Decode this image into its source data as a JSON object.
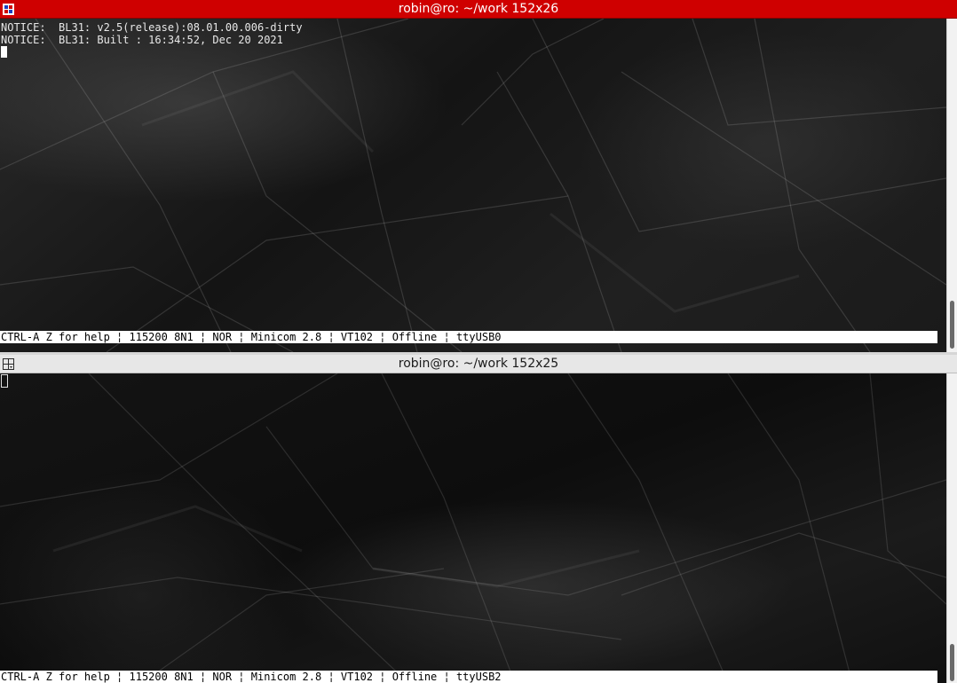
{
  "panes": [
    {
      "title": "robin@ro: ~/work 152x26",
      "lines": [
        "NOTICE:  BL31: v2.5(release):08.01.00.006-dirty",
        "NOTICE:  BL31: Built : 16:34:52, Dec 20 2021"
      ],
      "status": "CTRL-A Z for help ¦ 115200 8N1 ¦ NOR ¦ Minicom 2.8 ¦ VT102 ¦ Offline ¦ ttyUSB0",
      "active": true
    },
    {
      "title": "robin@ro: ~/work 152x25",
      "lines": [],
      "status": "CTRL-A Z for help ¦ 115200 8N1 ¦ NOR ¦ Minicom 2.8 ¦ VT102 ¦ Offline ¦ ttyUSB2",
      "active": false
    }
  ],
  "colors": {
    "active_titlebar": "#cf0000",
    "inactive_titlebar": "#e7e7e7",
    "terminal_text": "#e8e8e8",
    "statusbar_bg": "#ffffff"
  },
  "icons": {
    "pane_icon": "terminal-split-icon"
  }
}
